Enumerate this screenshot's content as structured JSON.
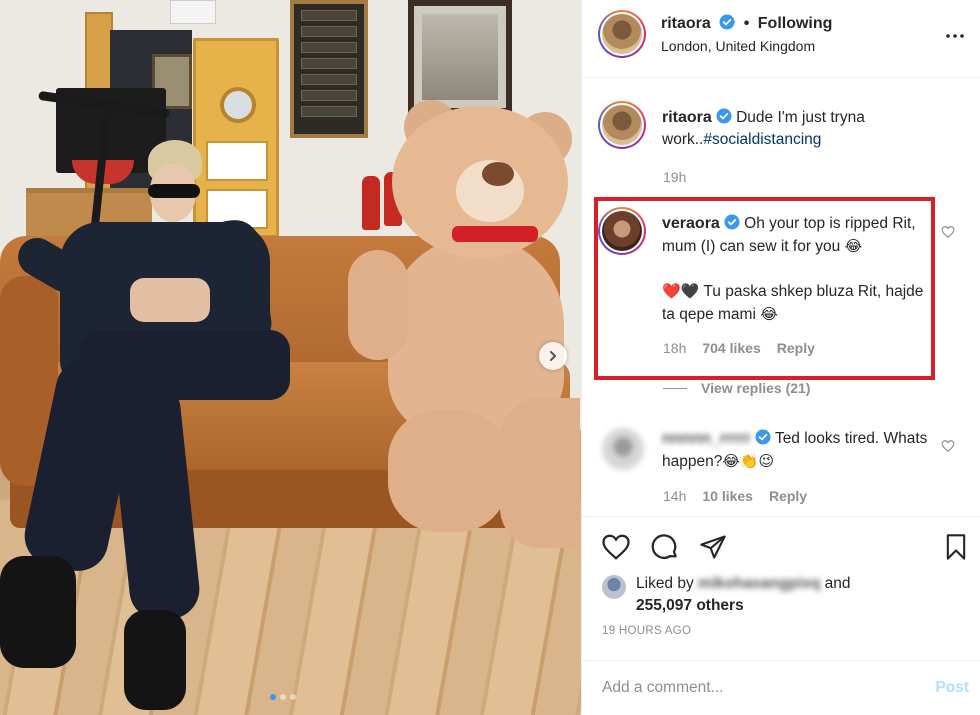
{
  "post": {
    "author": "ritaora",
    "following_label": "Following",
    "location": "London, United Kingdom",
    "separator": "•"
  },
  "comments": [
    {
      "username": "ritaora",
      "text_main": "Dude I'm just tryna work..",
      "hashtag": "#socialdistancing",
      "time": "19h"
    },
    {
      "username": "veraora",
      "text_line1": "Oh your top is ripped Rit, mum (I) can sew it for you",
      "emoji1": "😂",
      "hearts": "❤️🖤",
      "text_line2": "Tu paska shkep bluza Rit, hajde ta qepe mami",
      "emoji2": "😂",
      "time": "18h",
      "likes": "704 likes",
      "reply": "Reply"
    },
    {
      "view_replies": "View replies (21)"
    },
    {
      "username": "nnnnn_rrrrr",
      "text": "Ted looks tired. Whats happen?",
      "emoji": "😂👏😉",
      "time": "14h",
      "likes": "10 likes",
      "reply": "Reply"
    }
  ],
  "likes": {
    "prefix": "Liked by",
    "user": "mikohaxangpixq",
    "conj": "and",
    "others": "255,097 others"
  },
  "timestamp": "19 HOURS AGO",
  "add_comment": {
    "placeholder": "Add a comment...",
    "post_label": "Post"
  },
  "colors": {
    "highlight": "#d61f26",
    "verified": "#3897f0",
    "hashtag": "#00376b",
    "meta": "#8e8e8e",
    "post_disabled": "#b2dffc"
  },
  "icons": {
    "verified": "verified-badge-icon",
    "more": "more-options-icon",
    "heart": "heart-icon",
    "comment": "comment-icon",
    "share": "share-icon",
    "save": "bookmark-icon",
    "next": "chevron-right-icon"
  }
}
